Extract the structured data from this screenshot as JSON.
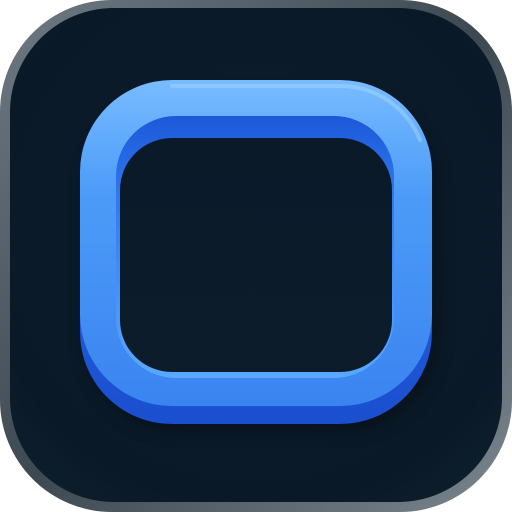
{
  "app_icon": {
    "icon": "rounded-square-frame-icon",
    "colors": {
      "background_dark": "#0a1a28",
      "background_edge": "#5e6a74",
      "frame_light": "#7cc0ff",
      "frame_mid": "#3e8ef5",
      "frame_dark": "#1f5fe0",
      "inner_hole": "#0b1b2a"
    }
  }
}
